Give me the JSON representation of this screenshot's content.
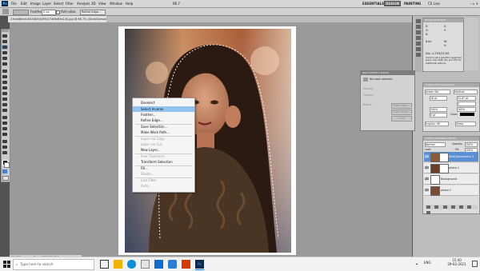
{
  "menubar": {
    "items": [
      "File",
      "Edit",
      "Image",
      "Layer",
      "Select",
      "Filter",
      "Analysis",
      "3D",
      "View",
      "Window",
      "Help"
    ],
    "zoom": "66.7",
    "workspaces": [
      "ESSENTIALS",
      "DESIGN",
      "PAINTING"
    ],
    "cs_live": "CS Live"
  },
  "options": {
    "feather_label": "Feather:",
    "feather_value": "0 px",
    "antialias_label": "Anti-alias",
    "style_label": "Refine Edge..."
  },
  "document": {
    "tab_title": "23ed48e0d1643483d2990274f8e83e100.jpg @ 66.7% (Shot/Salmonline 3, RGB/8) *",
    "zoom_status": "66.67%",
    "doc_status": "Doc: 4.37M/23.2M"
  },
  "context_menu": {
    "items": [
      {
        "label": "Deselect",
        "disabled": false,
        "highlight": false
      },
      {
        "label": "Select Inverse",
        "disabled": false,
        "highlight": true
      },
      {
        "label": "Feather...",
        "disabled": false,
        "highlight": false
      },
      {
        "label": "Refine Edge...",
        "disabled": false,
        "highlight": false
      },
      {
        "label": "Save Selection...",
        "disabled": false,
        "highlight": false
      },
      {
        "label": "Make Work Path...",
        "disabled": false,
        "highlight": false
      },
      {
        "label": "Layer via Copy",
        "disabled": true,
        "highlight": false
      },
      {
        "label": "Layer via Cut",
        "disabled": true,
        "highlight": false
      },
      {
        "label": "New Layer...",
        "disabled": false,
        "highlight": false
      },
      {
        "label": "Free Transform",
        "disabled": true,
        "highlight": false
      },
      {
        "label": "Transform Selection",
        "disabled": false,
        "highlight": false
      },
      {
        "label": "Fill...",
        "disabled": false,
        "highlight": false
      },
      {
        "label": "Stroke...",
        "disabled": true,
        "highlight": false
      },
      {
        "label": "Last Filter",
        "disabled": true,
        "highlight": false
      },
      {
        "label": "Fade...",
        "disabled": true,
        "highlight": false
      }
    ]
  },
  "float_panel": {
    "tab1": "ADJUSTMENTS",
    "tab2": "MASKS",
    "status": "No mask selected",
    "density_label": "Density:",
    "feather_label": "Feather:",
    "refine_label": "Refine:",
    "mask_edge": "Mask Edge...",
    "color_range": "Color Range...",
    "invert": "Invert"
  },
  "histogram_panel": {
    "tab1": "HISTOGRAM",
    "tab2": "NAVIGATOR",
    "tab3": "INFO",
    "r": "R:",
    "g": "G:",
    "b": "B:",
    "x": "X:",
    "y": "Y:",
    "w": "W:",
    "h": "H:",
    "bits": "8-bit",
    "doc": "Doc: 4.37M/23.2M",
    "hint": "Click to set a selection segment point. Use Shift, Alt, and Ctrl for additional options."
  },
  "character_panel": {
    "tab1": "CHARACTER",
    "tab2": "PARAGRAPH",
    "font": "Arabic Std",
    "style": "Medium",
    "size": "16 pt",
    "leading": "31.87 pt",
    "tracking": "0",
    "vscale": "100%",
    "hscale": "100%",
    "baseline": "0 pt",
    "color_label": "Color:",
    "language": "English: UK",
    "aa": "Sharp"
  },
  "layers_panel": {
    "tab1": "LAYERS",
    "tab2": "CHANNELS",
    "tab3": "PATHS",
    "blend": "Normal",
    "opacity_label": "Opacity:",
    "opacity": "100%",
    "lock_label": "Lock:",
    "fill_label": "Fill:",
    "fill": "100%",
    "layers": [
      {
        "name": "Shot/Salmonline 3",
        "selected": true,
        "mask": true
      },
      {
        "name": "photo 1",
        "selected": false,
        "mask": true
      },
      {
        "name": "Background",
        "selected": false,
        "mask": false
      },
      {
        "name": "photo 2",
        "selected": false,
        "mask": false
      }
    ]
  },
  "taskbar": {
    "search_placeholder": "Type here to search",
    "time": "15:40",
    "date": "29-02-2021",
    "lang": "ENG"
  }
}
